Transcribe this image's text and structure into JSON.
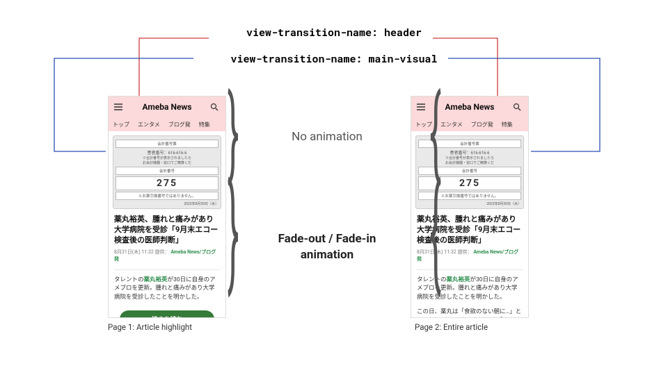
{
  "props": {
    "header": "view-transition-name: header",
    "main_visual": "view-transition-name: main-visual"
  },
  "annotations": {
    "no_anim": "No animation",
    "fade_line1": "Fade-out / Fade-in",
    "fade_line2": "animation"
  },
  "captions": {
    "page1": "Page 1: Article highlight",
    "page2": "Page 2: Entire article"
  },
  "phone": {
    "logo": "Ameba News",
    "tabs": [
      "トップ",
      "エンタメ",
      "ブログ発",
      "特集"
    ],
    "ticket": {
      "top_strip": "会計番号票",
      "line1": "患者番号：616-616-6",
      "line2": "※合計番号が表示されましたら\n  お会計機器・窓口でご精算くだ",
      "label": "会計番号",
      "number": "275",
      "note": "※お薬引換番号ではありません。",
      "date": "2023年8月30日（水）"
    },
    "headline": "薬丸裕英、腫れと痛みがあり大学病院を受診「9月末エコー検査後の医師判断」",
    "meta_time": "8月31日(木) 11:32",
    "meta_label": "提供：",
    "meta_source": "Ameba News/ブログ発",
    "excerpt_pre": "タレントの",
    "excerpt_link": "薬丸裕英",
    "excerpt_post": "が30日に自身のアメブロを更新。腫れと痛みがあり大学病院を受診したことを明かした。",
    "cta": "続きを読む",
    "para2": "この日、薬丸は「食欲のない朝に…」というタイトルでブログを更新。「本日の朝食」と切り出し、「自"
  }
}
